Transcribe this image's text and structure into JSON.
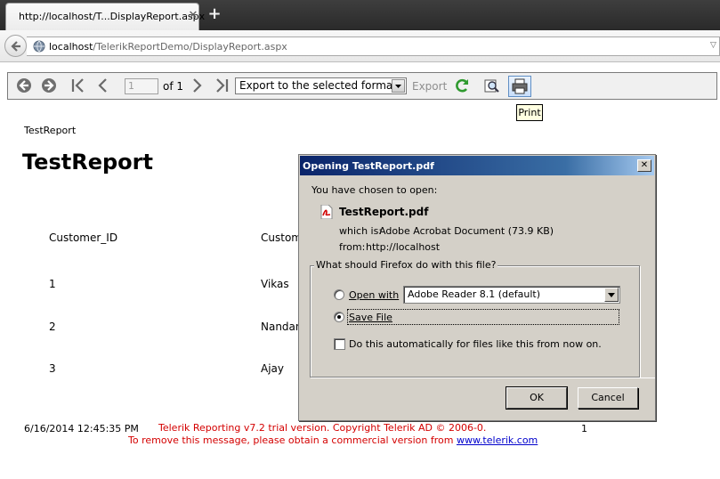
{
  "browser": {
    "tab_title": "http://localhost/T...DisplayReport.aspx",
    "url_host": "localhost",
    "url_path": "/TelerikReportDemo/DisplayReport.aspx"
  },
  "toolbar": {
    "page_number": "1",
    "page_of": "of 1",
    "export_format": "Export to the selected format",
    "export_label": "Export",
    "print_tooltip": "Print"
  },
  "report": {
    "header_small": "TestReport",
    "title": "TestReport",
    "columns": [
      "Customer_ID",
      "Custom"
    ],
    "rows": [
      {
        "id": "1",
        "name": "Vikas"
      },
      {
        "id": "2",
        "name": "Nandan"
      },
      {
        "id": "3",
        "name": "Ajay"
      }
    ],
    "footer": {
      "timestamp": "6/16/2014 12:45:35 PM",
      "trial_notice": "Telerik Reporting v7.2 trial version. Copyright Telerik AD © 2006-0.",
      "page": "1",
      "commercial_msg": "To remove this message, please obtain a commercial version from ",
      "commercial_link": "www.telerik.com"
    }
  },
  "dialog": {
    "title": "Opening TestReport.pdf",
    "chosen_label": "You have chosen to open:",
    "file_name": "TestReport.pdf",
    "which_is_label": "which is:",
    "which_is_value": "Adobe Acrobat Document (73.9 KB)",
    "from_label": "from:",
    "from_value": "http://localhost",
    "question": "What should Firefox do with this file?",
    "open_with_label": "Open with",
    "open_with_app": "Adobe Reader 8.1 (default)",
    "save_file_label": "Save File",
    "auto_label": "Do this automatically for files like this from now on.",
    "ok_label": "OK",
    "cancel_label": "Cancel",
    "selected_option": "save_file"
  }
}
